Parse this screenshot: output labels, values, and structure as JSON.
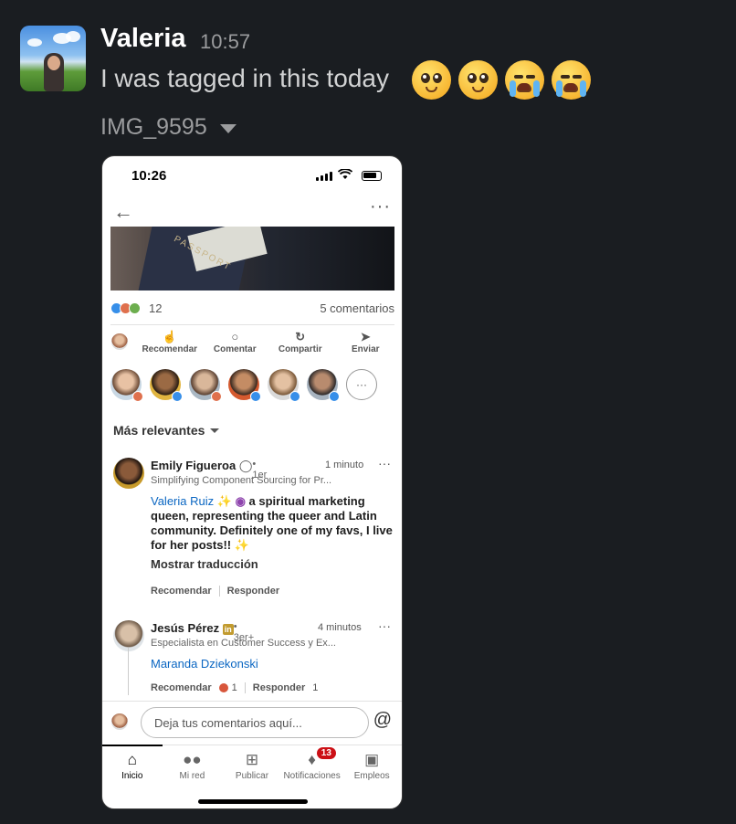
{
  "message": {
    "author": "Valeria",
    "time": "10:57",
    "text": "I was tagged in this today",
    "emojis": [
      "pleading-face",
      "pleading-face",
      "loudly-crying-face",
      "loudly-crying-face"
    ],
    "attachment_name": "IMG_9595"
  },
  "screenshot": {
    "status_time": "10:26",
    "reaction_count": "12",
    "comment_count": "5 comentarios",
    "actions": [
      "Recomendar",
      "Comentar",
      "Compartir",
      "Enviar"
    ],
    "sort_label": "Más relevantes",
    "comments": [
      {
        "name": "Emily Figueroa",
        "degree": "• 1er",
        "time": "1 minuto",
        "headline": "Simplifying Component Sourcing for Pr...",
        "mention": "Valeria Ruiz",
        "body_line1": "a spiritual marketing",
        "body_rest": "queen, representing the queer and Latin community. Definitely one of my favs, I live for her posts!!",
        "translate": "Mostrar traducción",
        "like": "Recomendar",
        "reply": "Responder"
      },
      {
        "name": "Jesús Pérez",
        "degree": "• 3er+",
        "time": "4 minutos",
        "headline": "Especialista en Customer Success y Ex...",
        "mention": "Maranda Dziekonski",
        "like": "Recomendar",
        "like_count": "1",
        "reply": "Responder",
        "reply_count": "1"
      }
    ],
    "composer_placeholder": "Deja tus comentarios aquí...",
    "tabs": [
      {
        "label": "Inicio",
        "icon": "home-icon"
      },
      {
        "label": "Mi red",
        "icon": "network-icon"
      },
      {
        "label": "Publicar",
        "icon": "plus-square-icon"
      },
      {
        "label": "Notificaciones",
        "icon": "bell-icon",
        "badge": "13"
      },
      {
        "label": "Empleos",
        "icon": "briefcase-icon"
      }
    ]
  },
  "colors": {
    "background": "#1a1d21",
    "linkedin_blue": "#0a66c2",
    "notification_red": "#cc1016"
  }
}
